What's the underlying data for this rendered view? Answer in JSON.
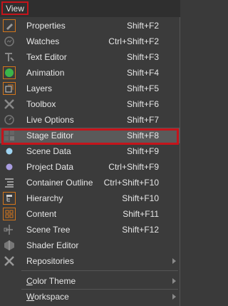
{
  "menubar": {
    "view_label": "View"
  },
  "menu": {
    "items": [
      {
        "label": "Properties",
        "shortcut": "Shift+F2",
        "icon": "properties-icon"
      },
      {
        "label": "Watches",
        "shortcut": "Ctrl+Shift+F2",
        "icon": "watches-icon"
      },
      {
        "label": "Text Editor",
        "shortcut": "Shift+F3",
        "icon": "text-editor-icon"
      },
      {
        "label": "Animation",
        "shortcut": "Shift+F4",
        "icon": "animation-icon"
      },
      {
        "label": "Layers",
        "shortcut": "Shift+F5",
        "icon": "layers-icon"
      },
      {
        "label": "Toolbox",
        "shortcut": "Shift+F6",
        "icon": "toolbox-icon"
      },
      {
        "label": "Live Options",
        "shortcut": "Shift+F7",
        "icon": "live-options-icon"
      },
      {
        "label": "Stage Editor",
        "shortcut": "Shift+F8",
        "icon": "stage-editor-icon"
      },
      {
        "label": "Scene Data",
        "shortcut": "Shift+F9",
        "icon": "scene-data-icon"
      },
      {
        "label": "Project Data",
        "shortcut": "Ctrl+Shift+F9",
        "icon": "project-data-icon"
      },
      {
        "label": "Container Outline",
        "shortcut": "Ctrl+Shift+F10",
        "icon": "container-outline-icon"
      },
      {
        "label": "Hierarchy",
        "shortcut": "Shift+F10",
        "icon": "hierarchy-icon"
      },
      {
        "label": "Content",
        "shortcut": "Shift+F11",
        "icon": "content-icon"
      },
      {
        "label": "Scene Tree",
        "shortcut": "Shift+F12",
        "icon": "scene-tree-icon"
      },
      {
        "label": "Shader Editor",
        "shortcut": "",
        "icon": "shader-editor-icon"
      },
      {
        "label": "Repositories",
        "shortcut": "",
        "icon": "repositories-icon"
      }
    ],
    "submenus": [
      {
        "label_first": "C",
        "label_rest": "olor Theme"
      },
      {
        "label_first": "W",
        "label_rest": "orkspace"
      }
    ]
  },
  "colors": {
    "highlight_border": "#c4141b",
    "accent_orange": "#d2761c",
    "animation_green": "#3bb54a",
    "scene_data_blue": "#9fd3f0",
    "project_data_purple": "#a99ce0"
  }
}
